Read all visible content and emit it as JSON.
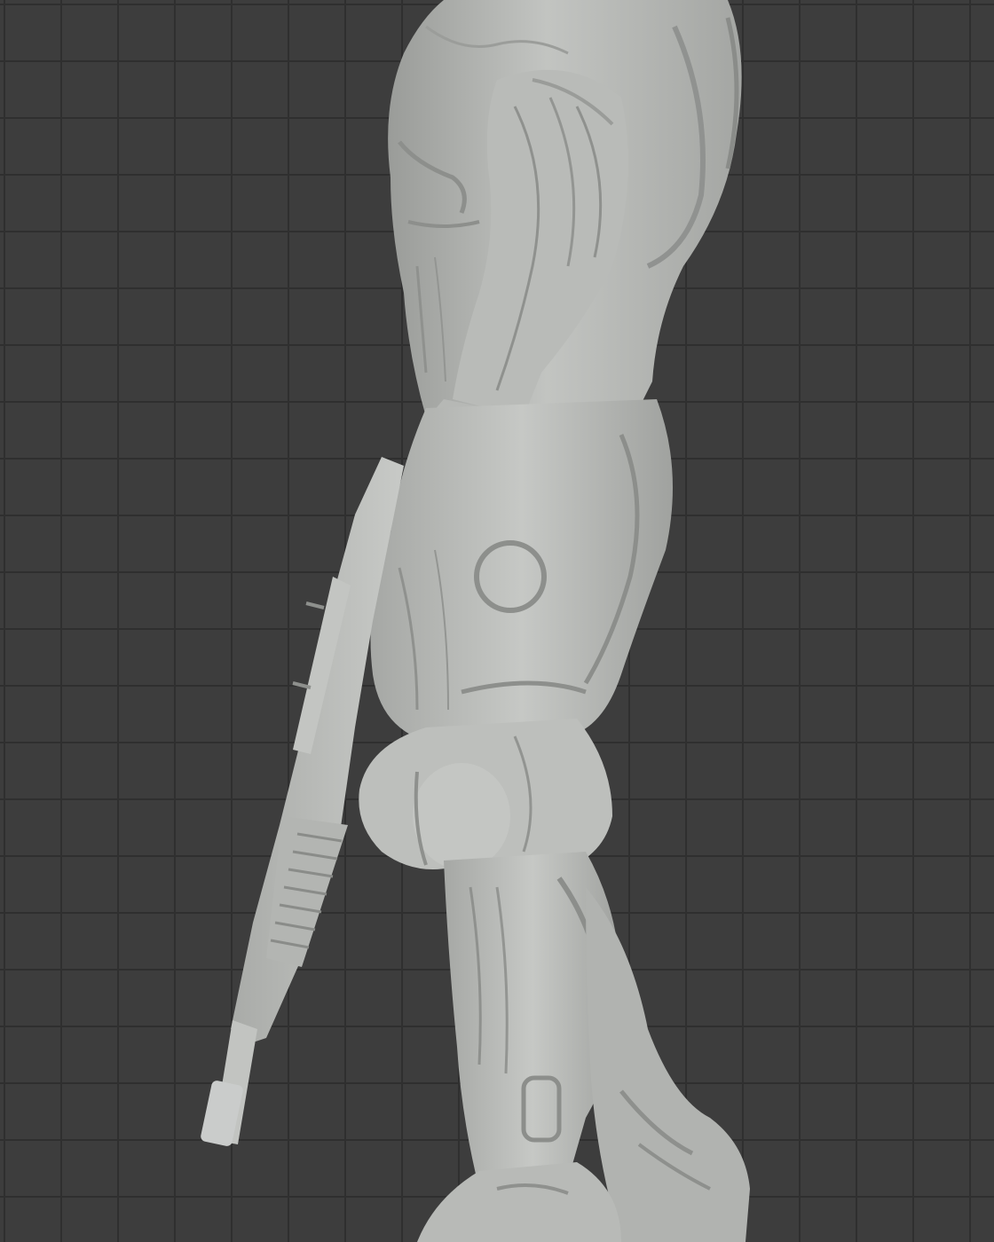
{
  "viewport": {
    "background_color": "#3d3d3d",
    "grid_line_color": "#2f2f2f",
    "model_color": "#b4b6b3",
    "model_shadow_color": "#8e908d",
    "model_highlight_color": "#cfd1ce"
  },
  "model": {
    "subject": "armored-nanosuit-soldier-sculpt",
    "view": "side-profile",
    "parts": [
      "torso",
      "arm",
      "fist",
      "rifle",
      "thigh",
      "knee",
      "calf",
      "boot"
    ]
  }
}
